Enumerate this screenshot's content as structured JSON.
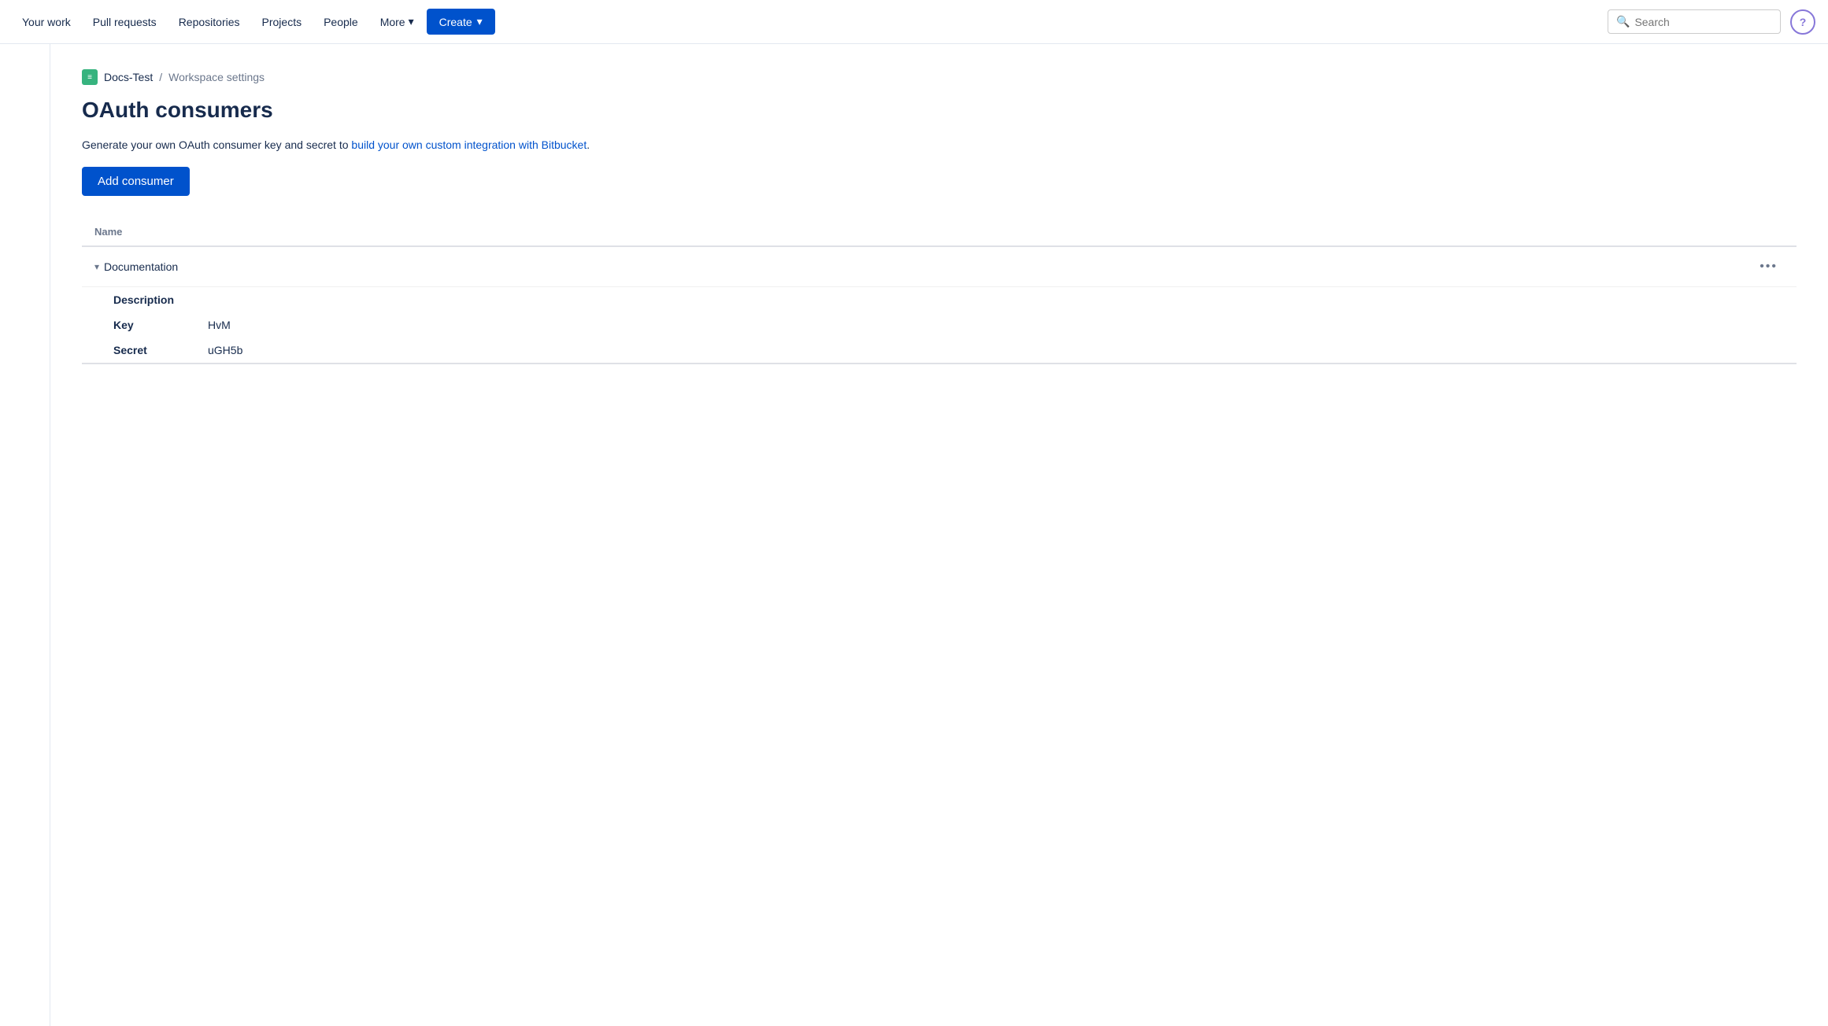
{
  "nav": {
    "your_work": "Your work",
    "pull_requests": "Pull requests",
    "repositories": "Repositories",
    "projects": "Projects",
    "people": "People",
    "more": "More",
    "create": "Create",
    "search_placeholder": "Search"
  },
  "breadcrumb": {
    "workspace": "Docs-Test",
    "separator": "/",
    "current": "Workspace settings"
  },
  "page": {
    "title": "OAuth consumers",
    "description_start": "Generate your own OAuth consumer key and secret to ",
    "description_link": "build your own custom integration with Bitbucket",
    "description_end": ".",
    "add_btn": "Add consumer"
  },
  "table": {
    "name_column": "Name",
    "consumers": [
      {
        "name": "Documentation",
        "expanded": true,
        "description": "",
        "key": "HvM",
        "secret": "uGH5b"
      }
    ]
  },
  "detail_labels": {
    "description": "Description",
    "key": "Key",
    "secret": "Secret"
  }
}
